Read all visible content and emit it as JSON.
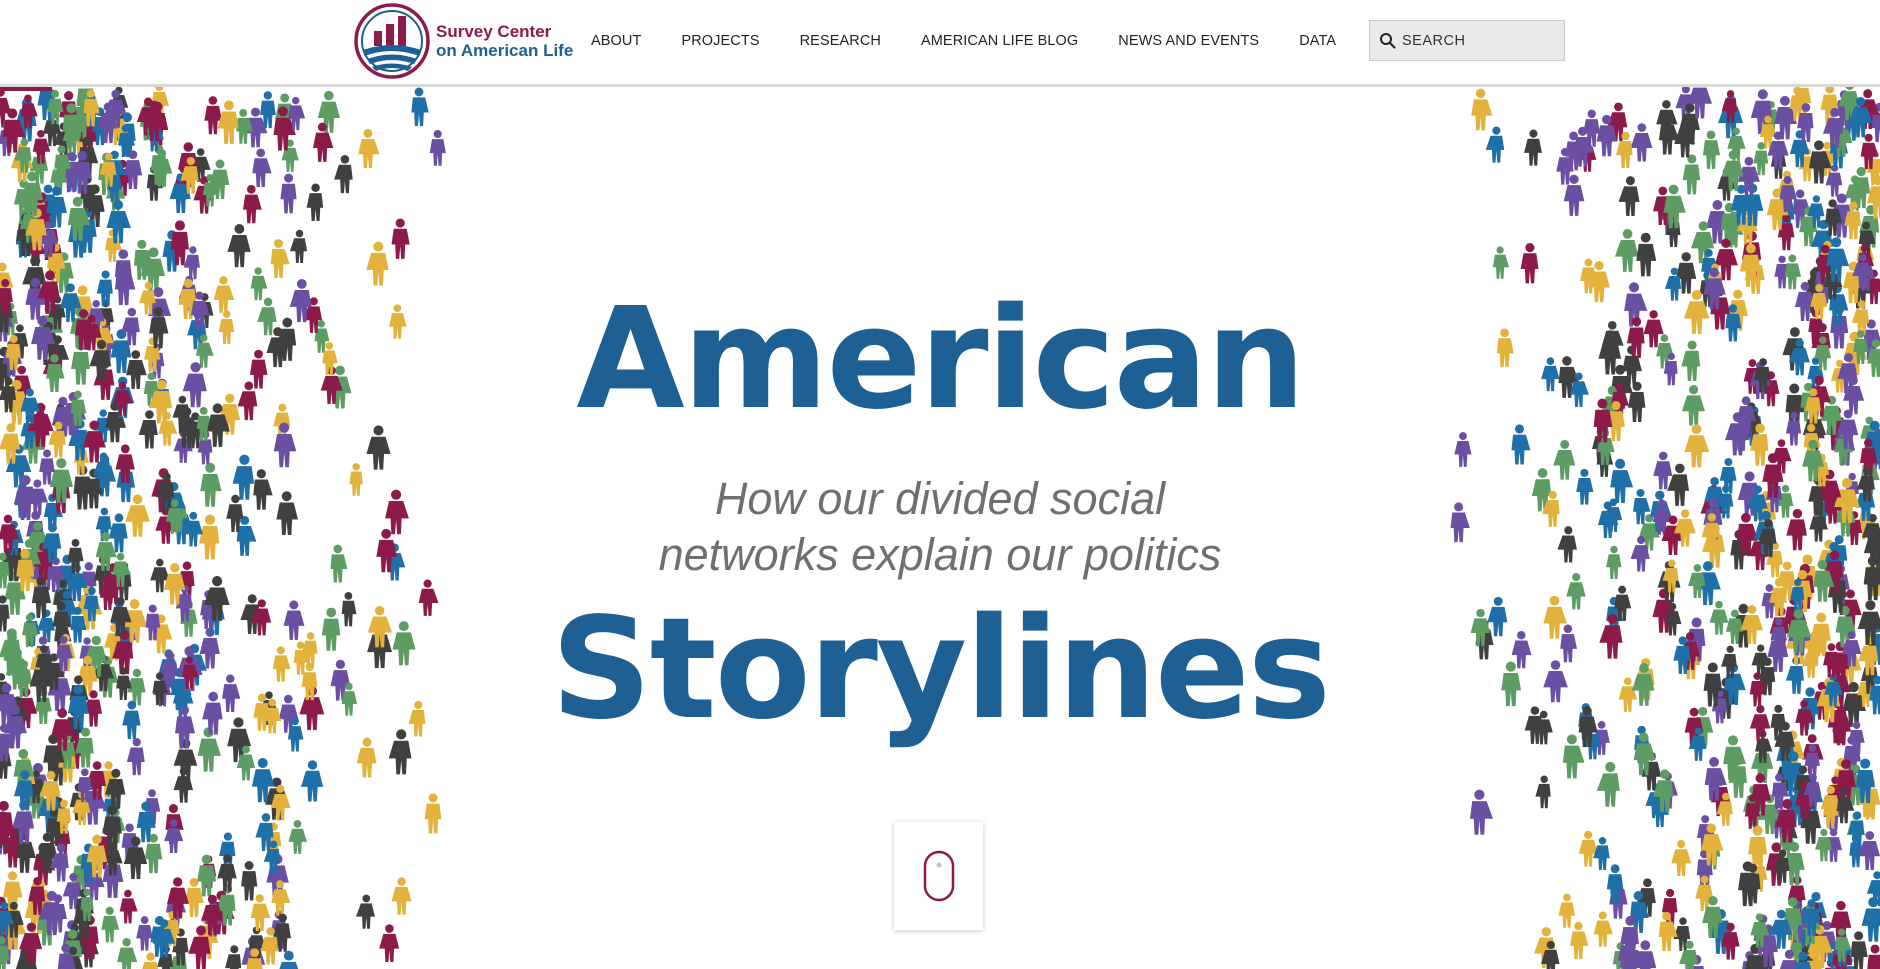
{
  "header": {
    "logo": {
      "line1": "Survey Center",
      "line2": "on American Life"
    },
    "nav": [
      {
        "label": "ABOUT"
      },
      {
        "label": "PROJECTS"
      },
      {
        "label": "RESEARCH"
      },
      {
        "label": "AMERICAN LIFE BLOG"
      },
      {
        "label": "NEWS AND EVENTS"
      },
      {
        "label": "DATA"
      }
    ],
    "search": {
      "placeholder": "SEARCH",
      "icon": "search-icon"
    }
  },
  "hero": {
    "title_top": "American",
    "subtitle_line1": "How our divided social",
    "subtitle_line2": "networks explain our politics",
    "title_bottom": "Storylines",
    "scroll_icon": "mouse-icon"
  },
  "colors": {
    "brand_blue": "#1e5f94",
    "brand_maroon": "#8c1a4b",
    "crowd": [
      "#8c1a4b",
      "#e3b23c",
      "#1f6fa8",
      "#6a4fa3",
      "#5d9c62",
      "#404040"
    ]
  }
}
